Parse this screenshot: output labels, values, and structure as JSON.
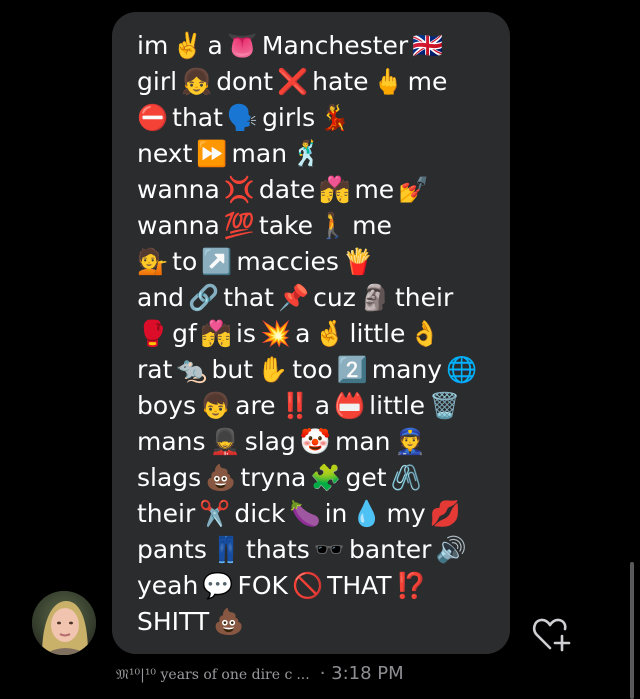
{
  "message": {
    "lines": [
      [
        "im",
        "✌️",
        "a",
        "👅",
        "Manchester",
        "🇬🇧"
      ],
      [
        "girl",
        "👧",
        "dont",
        "❌",
        "hate",
        "🖕",
        "me"
      ],
      [
        "⛔",
        "that",
        "🗣️",
        "girls",
        "💃"
      ],
      [
        "next",
        "⏩",
        "man",
        "🕺"
      ],
      [
        "wanna",
        "💢",
        "date",
        "💏",
        "me",
        "💅"
      ],
      [
        "wanna",
        "💯",
        "take",
        "🚶",
        "me"
      ],
      [
        "💁",
        "to",
        "↗️",
        "maccies",
        "🍟"
      ],
      [
        "and",
        "🔗",
        "that",
        "📌",
        "cuz",
        "🗿",
        "their"
      ],
      [
        "🥊",
        "gf",
        "💏",
        "is",
        "💥",
        "a",
        "🤞",
        "little",
        "👌"
      ],
      [
        "rat",
        "🐀",
        "but",
        "✋",
        "too",
        "2️⃣",
        "many",
        "🌐"
      ],
      [
        "boys",
        "👦",
        "are",
        "‼️",
        "a",
        "📛",
        "little",
        "🗑️"
      ],
      [
        "mans",
        "💂",
        "slag",
        "🤡",
        "man",
        "👮"
      ],
      [
        "slags",
        "💩",
        "tryna",
        "🧩",
        "get",
        "🖇️"
      ],
      [
        "their",
        "✂️",
        "dick",
        "🍆",
        "in",
        "💧",
        "my",
        "💋"
      ],
      [
        "pants",
        "👖",
        "thats",
        "🕶️",
        "banter",
        "🔊"
      ],
      [
        "yeah",
        "💬",
        "FOK",
        "🚫",
        "THAT",
        "⁉️"
      ],
      [
        "SHITT",
        "💩"
      ]
    ]
  },
  "footer": {
    "sender_name": "𝔐¹⁰|¹⁰ years of one dire c",
    "ellipsis": "...",
    "time": "· 3:18 PM"
  },
  "avatar": {
    "icon": "user-avatar-photo"
  },
  "like_button": {
    "icon": "heart-plus-icon"
  },
  "colors": {
    "background": "#000000",
    "bubble": "#2b2c2e",
    "text": "#ffffff",
    "meta": "#8e8e93"
  }
}
